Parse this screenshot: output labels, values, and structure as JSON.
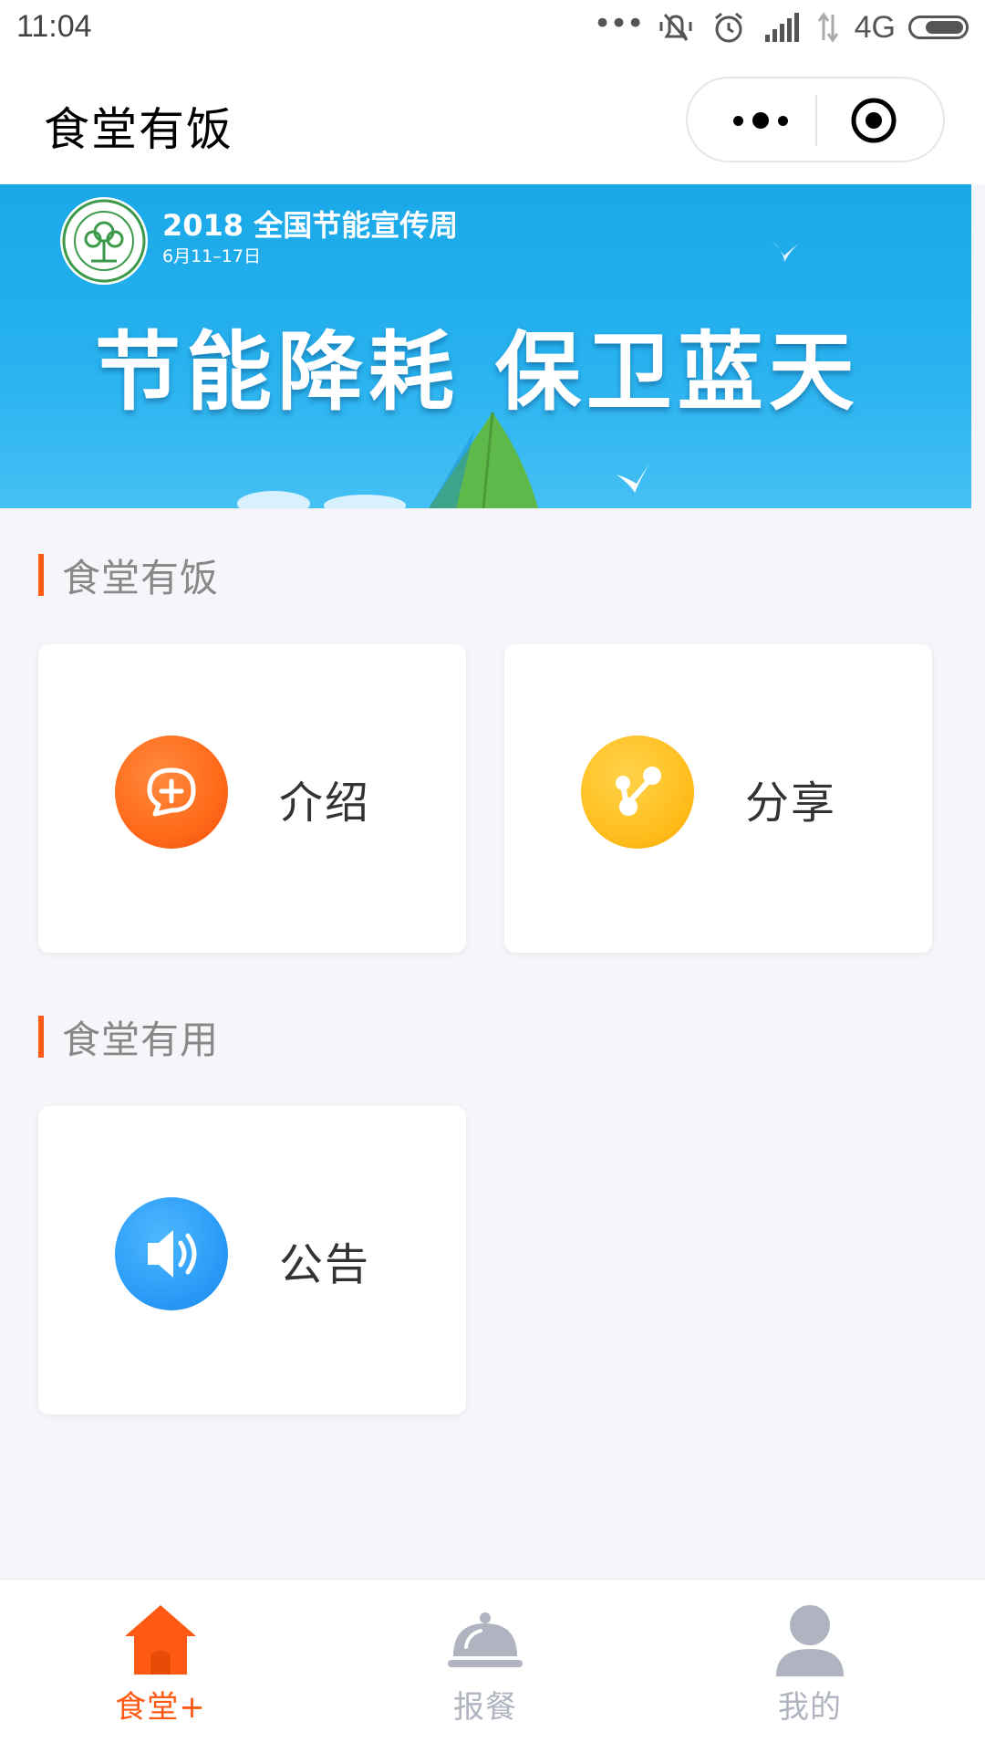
{
  "status_bar": {
    "time": "11:04",
    "dots": "•••",
    "network": "4G",
    "battery_fraction": 0.75,
    "icons": [
      "notifications-muted-icon",
      "alarm-icon",
      "signal-icon",
      "data-arrows-icon",
      "battery-icon"
    ]
  },
  "nav": {
    "title": "食堂有饭",
    "menu_icon": "more-dots-icon",
    "close_icon": "target-circle-icon"
  },
  "banner": {
    "title": "2018 全国节能宣传周",
    "date": "6月11–17日",
    "slogan": "节能降耗 保卫蓝天"
  },
  "sections": [
    {
      "title": "食堂有饭",
      "cards": [
        {
          "label": "介绍",
          "icon": "chat-plus-icon",
          "color": "#ff6a1a"
        },
        {
          "label": "分享",
          "icon": "share-icon",
          "color": "#ffbf20"
        }
      ]
    },
    {
      "title": "食堂有用",
      "cards": [
        {
          "label": "公告",
          "icon": "speaker-icon",
          "color": "#2c9cf7"
        }
      ]
    }
  ],
  "tabbar": {
    "items": [
      {
        "label": "食堂+",
        "icon": "home-icon",
        "active": true
      },
      {
        "label": "报餐",
        "icon": "cloche-icon",
        "active": false
      },
      {
        "label": "我的",
        "icon": "user-icon",
        "active": false
      }
    ],
    "active_color": "#ff5a14",
    "inactive_color": "#b0b4c0"
  }
}
